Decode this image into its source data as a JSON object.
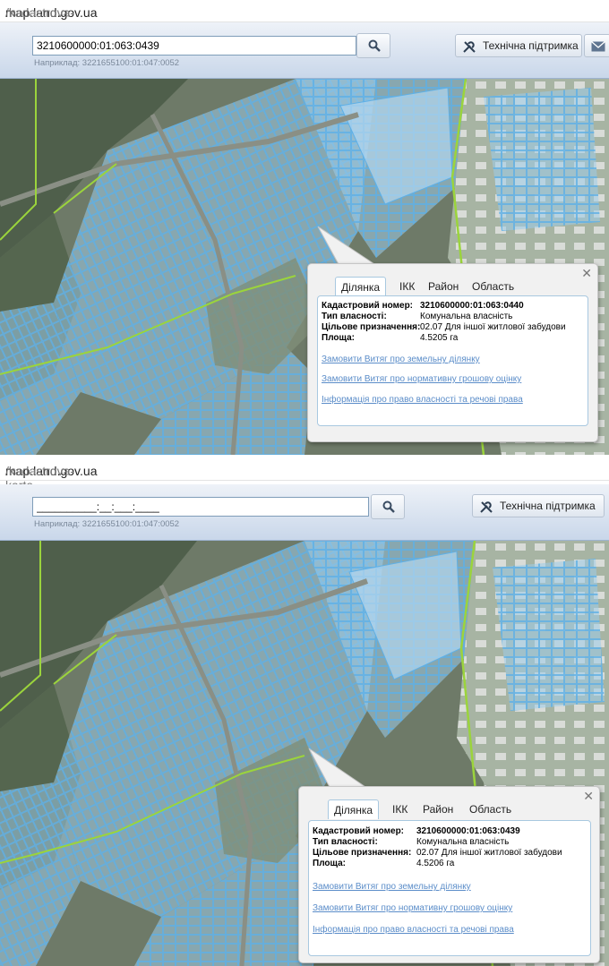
{
  "panel1": {
    "url": {
      "host": "map.land.gov.ua",
      "path": "/kadastrova-karta"
    },
    "search": {
      "value": "3210600000:01:063:0439",
      "example": "Наприклад: 3221655100:01:047:0052"
    },
    "support_label": "Технічна підтримка",
    "popup": {
      "tabs": [
        "Ділянка",
        "ІКК",
        "Район",
        "Область"
      ],
      "fields": [
        {
          "label": "Кадастровий номер:",
          "value": "3210600000:01:063:0440"
        },
        {
          "label": "Тип власності:",
          "value": "Комунальна власність"
        },
        {
          "label": "Цільове призначення:",
          "value": "02.07 Для іншої житлової забудови"
        },
        {
          "label": "Площа:",
          "value": "4.5205 га"
        }
      ],
      "links": [
        "Замовити Витяг про земельну ділянку",
        "Замовити Витяг про нормативну грошову оцінку",
        "Інформація про право власності та речові права"
      ]
    }
  },
  "panel2": {
    "url": {
      "host": "map.land.gov.ua",
      "path": "/kadastrova-karta"
    },
    "search": {
      "value": "__________:__:___:____",
      "example": "Наприклад: 3221655100:01:047:0052"
    },
    "support_label": "Технічна підтримка",
    "popup": {
      "tabs": [
        "Ділянка",
        "ІКК",
        "Район",
        "Область"
      ],
      "fields": [
        {
          "label": "Кадастровий номер:",
          "value": "3210600000:01:063:0439"
        },
        {
          "label": "Тип власності:",
          "value": "Комунальна власність"
        },
        {
          "label": "Цільове призначення:",
          "value": "02.07 Для іншої житлової забудови"
        },
        {
          "label": "Площа:",
          "value": "4.5206 га"
        }
      ],
      "links": [
        "Замовити Витяг про земельну ділянку",
        "Замовити Витяг про нормативну грошову оцінку",
        "Інформація про право власності та речові права"
      ]
    }
  },
  "colors": {
    "parcel_fill": "#8ec8ec",
    "parcel_stroke": "#63b2e6",
    "boundary": "#9bd43c",
    "forest": "#556650",
    "link": "#5b8dc9"
  },
  "icons": [
    "search-icon",
    "tools-icon",
    "mail-icon",
    "close-icon"
  ]
}
